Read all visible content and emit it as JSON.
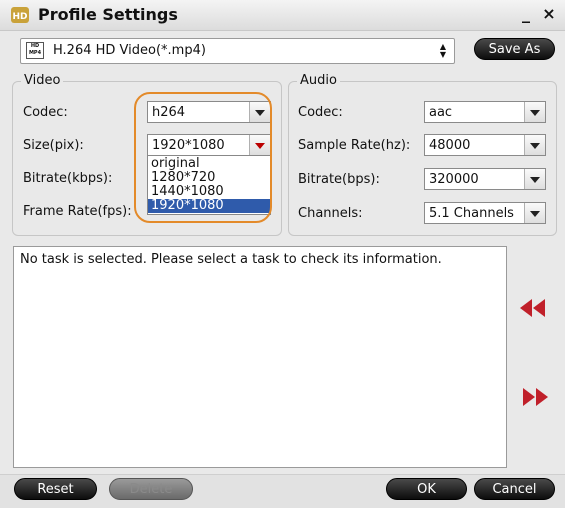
{
  "window": {
    "title": "Profile Settings",
    "minimize_glyph": "_",
    "close_glyph": "×",
    "app_icon": "hd-logo-icon"
  },
  "format": {
    "value": "H.264 HD Video(*.mp4)",
    "icon_label": "HD MP4",
    "save_as_label": "Save As"
  },
  "video": {
    "legend": "Video",
    "codec_label": "Codec:",
    "codec_value": "h264",
    "size_label": "Size(pix):",
    "size_value": "1920*1080",
    "size_options": [
      "original",
      "1280*720",
      "1440*1080",
      "1920*1080"
    ],
    "size_selected_index": 3,
    "bitrate_label": "Bitrate(kbps):",
    "framerate_label": "Frame Rate(fps):"
  },
  "audio": {
    "legend": "Audio",
    "codec_label": "Codec:",
    "codec_value": "aac",
    "samplerate_label": "Sample Rate(hz):",
    "samplerate_value": "48000",
    "bitrate_label": "Bitrate(bps):",
    "bitrate_value": "320000",
    "channels_label": "Channels:",
    "channels_value": "5.1 Channels"
  },
  "info": {
    "text": "No task is selected. Please select a task to check its information."
  },
  "buttons": {
    "reset": "Reset",
    "delete": "Delete",
    "ok": "OK",
    "cancel": "Cancel"
  },
  "colors": {
    "highlight": "#e38a2a",
    "selection": "#2f5bab",
    "arrow_red": "#c0202a"
  }
}
